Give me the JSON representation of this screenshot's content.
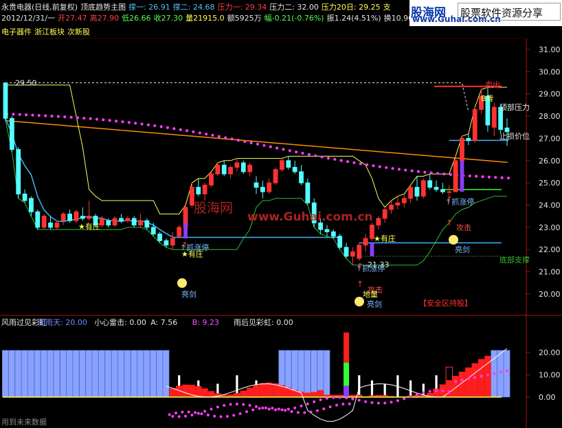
{
  "header": {
    "line1": [
      {
        "text": "永贵电器(日线,前复权)",
        "color": "#e6e6e6"
      },
      {
        "text": "顶底趋势主图",
        "color": "#e6e6e6"
      },
      {
        "text": "撑一: 26.91",
        "color": "#4fc3f7"
      },
      {
        "text": "撑二: 24.68",
        "color": "#4fc3f7"
      },
      {
        "text": "压力一: 29.34",
        "color": "#ff4040"
      },
      {
        "text": "压力二: 32.00",
        "color": "#e6e6e6"
      },
      {
        "text": "压力20日: 29.25",
        "color": "#ffff54"
      },
      {
        "text": "支",
        "color": "#ffff54"
      }
    ],
    "line2": [
      {
        "text": "2012/12/31/一",
        "color": "#e6e6e6"
      },
      {
        "text": "开27.47",
        "color": "#ff4040"
      },
      {
        "text": "高27.90",
        "color": "#ff4040"
      },
      {
        "text": "低26.66",
        "color": "#54ff54"
      },
      {
        "text": "收27.30",
        "color": "#54ff54"
      },
      {
        "text": "量21915.0",
        "color": "#ffff54"
      },
      {
        "text": "额5925万",
        "color": "#e6e6e6"
      },
      {
        "text": "幅-0.21(-0.76%)",
        "color": "#54ff54"
      },
      {
        "text": "振1.24(4.51%)",
        "color": "#e6e6e6"
      },
      {
        "text": "换10.96",
        "color": "#e6e6e6"
      }
    ],
    "line3": [
      {
        "text": "电子器件",
        "color": "#ffff54"
      },
      {
        "text": "浙江板块",
        "color": "#ffff54"
      },
      {
        "text": "次新股",
        "color": "#ffff54"
      }
    ]
  },
  "banner": {
    "logo_cn": "股海网",
    "logo_url": "www.Guhai.com.cn",
    "slogan": "股票软件资源分享"
  },
  "watermark": {
    "cn": "股海网",
    "url": "www.Guhai.com.cn"
  },
  "chart_data": [
    {
      "type": "candlestick",
      "title": "顶底趋势主图",
      "y_ticks": [
        "31.00",
        "30.00",
        "29.00",
        "28.00",
        "27.00",
        "26.00",
        "25.00",
        "24.00",
        "23.00",
        "22.00",
        "21.00",
        "20.00"
      ],
      "ylim": [
        19.5,
        31.5
      ],
      "candles": [
        [
          29.5,
          29.4,
          27.8,
          27.9
        ],
        [
          27.9,
          28.0,
          26.4,
          26.5
        ],
        [
          26.5,
          26.6,
          24.3,
          24.5
        ],
        [
          24.5,
          24.7,
          24.1,
          24.2
        ],
        [
          24.3,
          24.4,
          23.5,
          23.7
        ],
        [
          23.7,
          23.8,
          22.9,
          23.0
        ],
        [
          23.0,
          23.6,
          22.9,
          23.5
        ],
        [
          23.2,
          23.5,
          22.9,
          23.0
        ],
        [
          23.0,
          23.3,
          22.9,
          23.2
        ],
        [
          23.3,
          23.7,
          23.1,
          23.6
        ],
        [
          23.6,
          23.8,
          23.2,
          23.3
        ],
        [
          23.3,
          23.8,
          23.2,
          23.7
        ],
        [
          23.5,
          23.9,
          23.3,
          23.4
        ],
        [
          23.4,
          24.2,
          23.3,
          23.5
        ],
        [
          23.5,
          23.6,
          23.0,
          23.1
        ],
        [
          23.1,
          23.5,
          23.0,
          23.4
        ],
        [
          23.3,
          23.4,
          23.0,
          23.1
        ],
        [
          23.1,
          23.5,
          23.0,
          23.4
        ],
        [
          23.4,
          23.6,
          23.2,
          23.3
        ],
        [
          23.3,
          23.5,
          23.2,
          23.4
        ],
        [
          23.4,
          23.5,
          23.0,
          23.1
        ],
        [
          23.1,
          23.6,
          23.0,
          23.3
        ],
        [
          23.3,
          23.4,
          22.9,
          23.0
        ],
        [
          23.0,
          23.2,
          22.6,
          22.7
        ],
        [
          22.7,
          22.8,
          22.3,
          22.4
        ],
        [
          22.4,
          22.5,
          22.1,
          22.2
        ],
        [
          22.2,
          22.8,
          22.0,
          22.5
        ],
        [
          22.6,
          23.1,
          22.5,
          23.0
        ],
        [
          23.0,
          24.0,
          22.9,
          23.9
        ],
        [
          24.0,
          25.0,
          23.9,
          24.8
        ],
        [
          24.8,
          25.2,
          24.4,
          24.5
        ],
        [
          24.5,
          25.0,
          24.2,
          24.9
        ],
        [
          24.9,
          25.5,
          24.8,
          25.4
        ],
        [
          25.4,
          25.9,
          25.3,
          25.8
        ],
        [
          25.8,
          26.0,
          25.3,
          25.4
        ],
        [
          25.4,
          25.8,
          25.2,
          25.7
        ],
        [
          25.7,
          26.1,
          25.5,
          25.9
        ],
        [
          25.9,
          26.0,
          25.4,
          25.5
        ],
        [
          25.5,
          25.9,
          25.3,
          25.8
        ],
        [
          25.0,
          25.3,
          24.5,
          24.8
        ],
        [
          24.8,
          25.1,
          24.3,
          24.6
        ],
        [
          24.6,
          25.2,
          24.5,
          25.0
        ],
        [
          25.0,
          25.7,
          24.9,
          25.6
        ],
        [
          25.6,
          26.1,
          25.5,
          26.0
        ],
        [
          26.0,
          26.2,
          25.6,
          25.7
        ],
        [
          25.7,
          26.0,
          25.4,
          25.5
        ],
        [
          25.5,
          25.8,
          24.9,
          25.0
        ],
        [
          25.0,
          25.2,
          24.0,
          24.1
        ],
        [
          24.1,
          24.3,
          23.0,
          23.2
        ],
        [
          23.2,
          23.4,
          22.7,
          22.9
        ],
        [
          22.9,
          23.1,
          22.6,
          22.8
        ],
        [
          22.8,
          22.9,
          22.5,
          22.6
        ],
        [
          22.6,
          22.7,
          22.0,
          22.1
        ],
        [
          22.1,
          22.3,
          21.6,
          21.7
        ],
        [
          21.7,
          22.1,
          21.3,
          21.9
        ],
        [
          21.6,
          22.3,
          21.5,
          22.2
        ],
        [
          22.2,
          22.7,
          21.9,
          22.5
        ],
        [
          22.5,
          23.2,
          22.4,
          23.1
        ],
        [
          23.1,
          23.5,
          22.9,
          23.4
        ],
        [
          23.4,
          23.9,
          23.2,
          23.8
        ],
        [
          23.8,
          24.2,
          23.6,
          24.0
        ],
        [
          24.0,
          24.4,
          23.8,
          24.1
        ],
        [
          24.1,
          24.5,
          23.9,
          24.3
        ],
        [
          24.3,
          24.9,
          24.1,
          24.8
        ],
        [
          24.8,
          25.3,
          24.2,
          24.4
        ],
        [
          24.4,
          25.2,
          24.3,
          25.1
        ],
        [
          25.1,
          25.4,
          24.7,
          24.8
        ],
        [
          24.8,
          25.1,
          24.6,
          24.7
        ],
        [
          24.7,
          25.0,
          24.5,
          24.6
        ],
        [
          24.6,
          24.9,
          24.4,
          24.6
        ],
        [
          24.6,
          26.2,
          24.6,
          26.0
        ],
        [
          26.0,
          27.1,
          25.8,
          27.0
        ],
        [
          27.0,
          27.2,
          26.7,
          26.9
        ],
        [
          26.9,
          28.4,
          26.8,
          28.3
        ],
        [
          28.3,
          29.2,
          28.1,
          28.9
        ],
        [
          28.9,
          29.3,
          27.3,
          27.6
        ],
        [
          27.5,
          28.6,
          27.1,
          28.4
        ],
        [
          28.4,
          28.5,
          27.2,
          27.4
        ],
        [
          27.47,
          27.9,
          26.66,
          27.3
        ]
      ],
      "support_levels": {
        "撑一": 26.91,
        "撑二": 24.68
      },
      "resistance_levels": {
        "压力一": 29.34,
        "压力二": 32.0,
        "压力20日": 29.25
      },
      "price_labels": [
        "29.50",
        "21.33"
      ],
      "annotations": [
        "★有庄",
        "★有庄",
        "★有庄",
        "↑抓涨停",
        "↑抓涨停",
        "↑抓涨停",
        "亮剑",
        "亮剑",
        "亮剑",
        "攻击",
        "攻击",
        "地量",
        "底部支撑",
        "顶部压力",
        "止损价位",
        "卖出",
        "B背",
        "【安全区持股】"
      ]
    },
    {
      "type": "bar",
      "title": "风雨过见彩虹",
      "legend": [
        {
          "text": "风雨过见彩虹",
          "color": "#e6e6e6"
        },
        {
          "text": "阴雨天: 20.00",
          "color": "#6f8cff"
        },
        {
          "text": "小心雷击: 0.00",
          "color": "#e6e6e6"
        },
        {
          "text": "A: 7.56",
          "color": "#e6e6e6"
        },
        {
          "text": "B: 9.23",
          "color": "#ff50ff"
        },
        {
          "text": "雨后见彩虹: 0.00",
          "color": "#e6e6e6"
        }
      ],
      "y_ticks": [
        "20.00",
        "10.00",
        "0.00"
      ],
      "ylim": [
        -12,
        27
      ],
      "footer": "用到未来数据"
    }
  ],
  "colors": {
    "up": "#ff3232",
    "down": "#54ffff",
    "axis": "#b01010",
    "dots": "#ff3cff",
    "ma_orange": "#ff8c00",
    "ma_blue": "#3cb4ff",
    "ma_yellow": "#ffff54"
  }
}
